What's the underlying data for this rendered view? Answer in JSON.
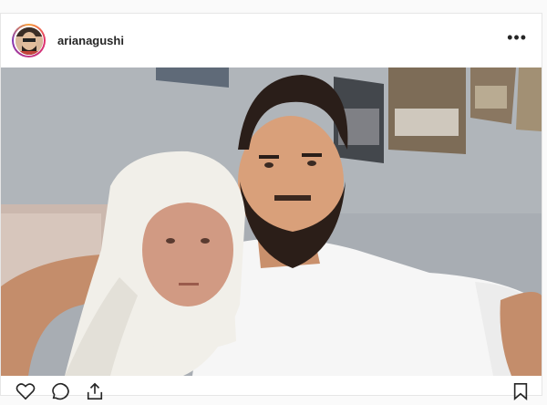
{
  "post": {
    "username": "arianagushi",
    "more_label": "...",
    "photo_alt": "",
    "icons": {
      "avatar": "avatar",
      "more": "more-options-icon",
      "like": "heart-icon",
      "comment": "comment-icon",
      "share": "share-icon",
      "save": "bookmark-icon"
    }
  }
}
